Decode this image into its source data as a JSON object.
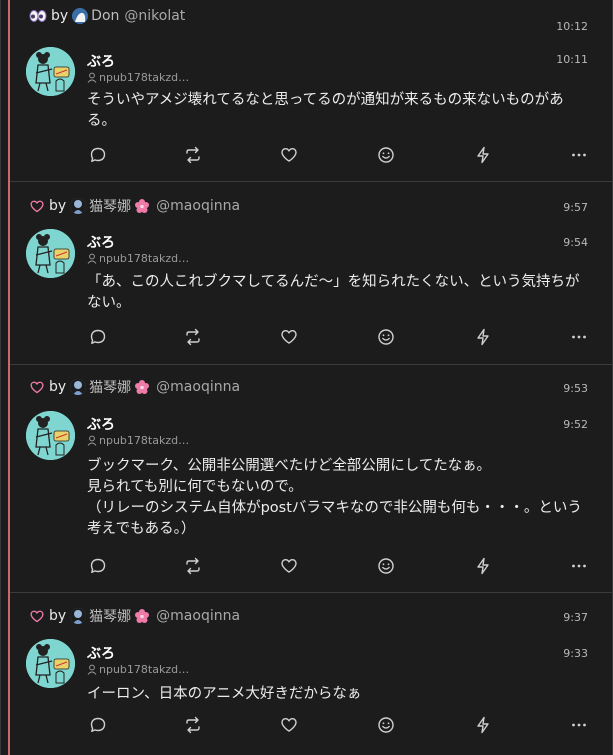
{
  "posts": [
    {
      "reaction_icon": "eyes-icon",
      "by_label": "by",
      "reactor_name": "Don",
      "reactor_handle": "@nikolat",
      "reaction_time": "10:12",
      "author_name": "ぶろ",
      "author_npub": "npub178takzd…",
      "post_time": "10:11",
      "content": "そういやアメジ壊れてるなと思ってるのが通知が来るもの来ないものがある。"
    },
    {
      "reaction_icon": "heart-icon",
      "by_label": "by",
      "reactor_name": "猫琴娜",
      "reactor_handle": "@maoqinna",
      "reaction_time": "9:57",
      "author_name": "ぶろ",
      "author_npub": "npub178takzd…",
      "post_time": "9:54",
      "content": "「あ、この人これブクマしてるんだ〜」を知られたくない、という気持ちがない。"
    },
    {
      "reaction_icon": "heart-icon",
      "by_label": "by",
      "reactor_name": "猫琴娜",
      "reactor_handle": "@maoqinna",
      "reaction_time": "9:53",
      "author_name": "ぶろ",
      "author_npub": "npub178takzd…",
      "post_time": "9:52",
      "content": "ブックマーク、公開非公開選べたけど全部公開にしてたなぁ。\n見られても別に何でもないので。\n（リレーのシステム自体がpostバラマキなので非公開も何も・・・。という考えでもある。）"
    },
    {
      "reaction_icon": "heart-icon",
      "by_label": "by",
      "reactor_name": "猫琴娜",
      "reactor_handle": "@maoqinna",
      "reaction_time": "9:37",
      "author_name": "ぶろ",
      "author_npub": "npub178takzd…",
      "post_time": "9:33",
      "content": "イーロン、日本のアニメ大好きだからなぁ"
    }
  ],
  "action_icons": [
    "reply-icon",
    "repost-icon",
    "like-icon",
    "emoji-reaction-icon",
    "zap-icon",
    "more-icon"
  ],
  "colors": {
    "background": "#1c1c1c",
    "accent_bar": "#c86a6a",
    "avatar_bg": "#7fd6d0",
    "flower": "#f07aa8"
  }
}
